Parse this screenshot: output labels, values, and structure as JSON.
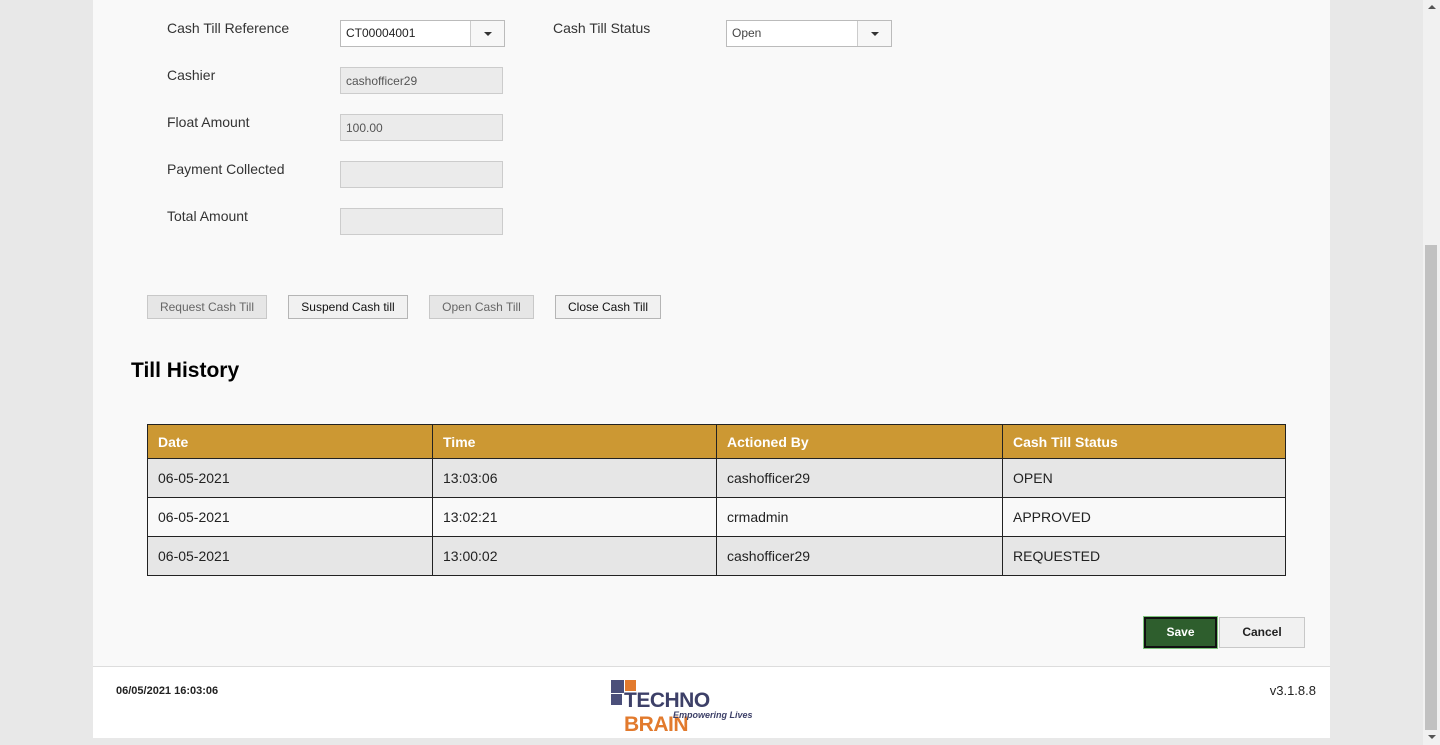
{
  "form": {
    "cash_till_reference": {
      "label": "Cash Till Reference",
      "value": "CT00004001"
    },
    "cash_till_status": {
      "label": "Cash Till Status",
      "value": "Open"
    },
    "cashier": {
      "label": "Cashier",
      "value": "cashofficer29"
    },
    "float_amount": {
      "label": "Float Amount",
      "value": "100.00"
    },
    "payment_collected": {
      "label": "Payment Collected",
      "value": ""
    },
    "total_amount": {
      "label": "Total Amount",
      "value": ""
    }
  },
  "actions": {
    "request": "Request Cash Till",
    "suspend": "Suspend Cash till",
    "open": "Open Cash Till",
    "close": "Close Cash Till"
  },
  "history": {
    "title": "Till History",
    "columns": [
      "Date",
      "Time",
      "Actioned By",
      "Cash Till Status"
    ],
    "rows": [
      [
        "06-05-2021",
        "13:03:06",
        "cashofficer29",
        "OPEN"
      ],
      [
        "06-05-2021",
        "13:02:21",
        "crmadmin",
        "APPROVED"
      ],
      [
        "06-05-2021",
        "13:00:02",
        "cashofficer29",
        "REQUESTED"
      ]
    ]
  },
  "buttons": {
    "save": "Save",
    "cancel": "Cancel"
  },
  "footer": {
    "timestamp": "06/05/2021 16:03:06",
    "version": "v3.1.8.8",
    "logo_main": "TECHNO",
    "logo_accent": "BRAIN",
    "logo_tagline": "Empowering Lives"
  },
  "colors": {
    "table_header": "#cc9833",
    "save_button": "#2e5e2d",
    "logo_primary": "#3d4068",
    "logo_accent": "#e27a2d"
  }
}
